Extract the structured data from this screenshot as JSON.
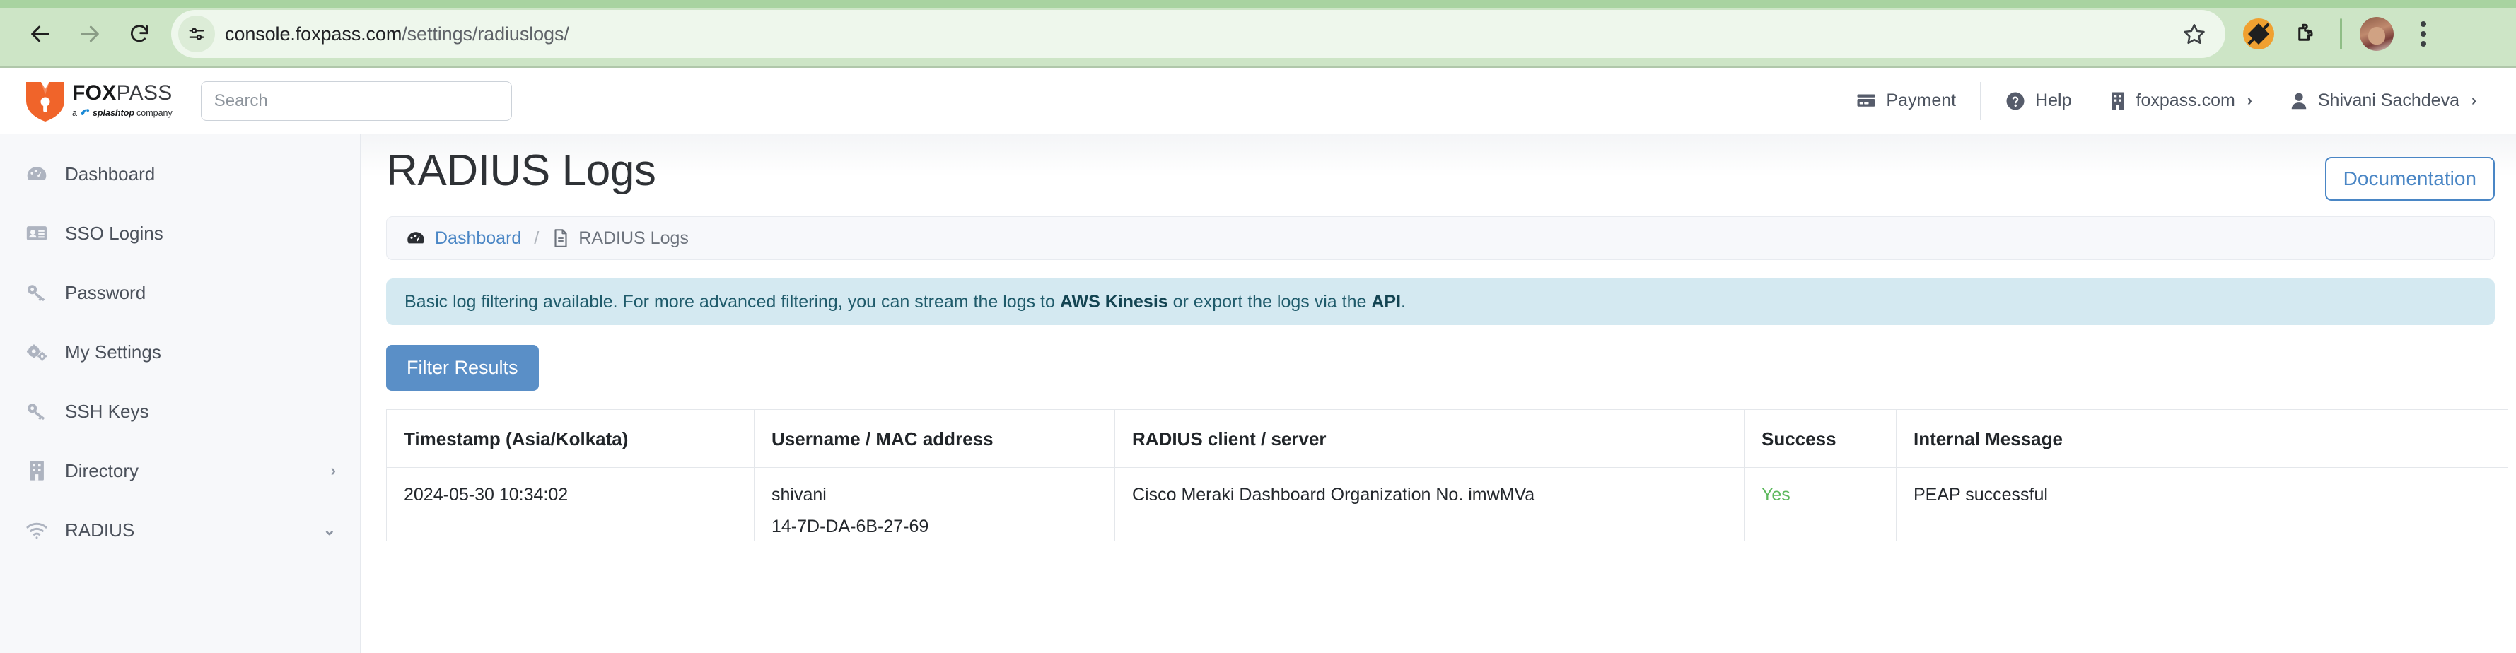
{
  "browser": {
    "back_icon": "back-arrow-icon",
    "forward_icon": "forward-arrow-icon",
    "reload_icon": "reload-icon",
    "site_info_icon": "site-settings-icon",
    "url_host": "console.foxpass.com",
    "url_path": "/settings/radiuslogs/",
    "bookmark_icon": "star-icon",
    "extension_icon": "extension-puzzle-icon",
    "adblock_icon": "adblock-extension-icon",
    "profile_icon": "profile-avatar",
    "menu_icon": "three-dot-menu-icon"
  },
  "header": {
    "brand_name_bold": "FOX",
    "brand_name_thin": "PASS",
    "brand_sub_prefix": "a",
    "brand_sub_company": "splashtop",
    "brand_sub_suffix": "company",
    "search_placeholder": "Search",
    "search_value": "",
    "payment_label": "Payment",
    "help_label": "Help",
    "org_label": "foxpass.com",
    "user_label": "Shivani Sachdeva",
    "caret": "›"
  },
  "sidebar": {
    "items": [
      {
        "label": "Dashboard",
        "icon": "gauge-icon",
        "chevron": ""
      },
      {
        "label": "SSO Logins",
        "icon": "id-card-icon",
        "chevron": ""
      },
      {
        "label": "Password",
        "icon": "key-icon",
        "chevron": ""
      },
      {
        "label": "My Settings",
        "icon": "gears-icon",
        "chevron": ""
      },
      {
        "label": "SSH Keys",
        "icon": "key-icon",
        "chevron": ""
      },
      {
        "label": "Directory",
        "icon": "building-icon",
        "chevron": "›"
      },
      {
        "label": "RADIUS",
        "icon": "wifi-icon",
        "chevron": "⌄"
      }
    ]
  },
  "main": {
    "page_title": "RADIUS Logs",
    "documentation_label": "Documentation",
    "breadcrumb": {
      "home_label": "Dashboard",
      "separator": "/",
      "current_label": "RADIUS Logs",
      "home_icon": "gauge-icon",
      "current_icon": "document-icon"
    },
    "alert": {
      "text_1": "Basic log filtering available. For more advanced filtering, you can stream the logs to ",
      "bold_1": "AWS Kinesis",
      "text_2": " or export the logs via the ",
      "bold_2": "API",
      "text_3": "."
    },
    "filter_button_label": "Filter Results",
    "table": {
      "columns": [
        "Timestamp (Asia/Kolkata)",
        "Username / MAC address",
        "RADIUS client / server",
        "Success",
        "Internal Message"
      ],
      "rows": [
        {
          "timestamp": "2024-05-30 10:34:02",
          "username": "shivani",
          "mac": "14-7D-DA-6B-27-69",
          "client": "Cisco Meraki Dashboard Organization No. imwMVa",
          "success": "Yes",
          "message": "PEAP successful"
        }
      ]
    }
  },
  "colors": {
    "chrome_bg": "#cde5c6",
    "brand_orange": "#f0642a",
    "link_blue": "#4a86c5",
    "primary_button": "#5a8fc7",
    "alert_bg": "#d4e9f1",
    "success_green": "#5cb85c"
  }
}
